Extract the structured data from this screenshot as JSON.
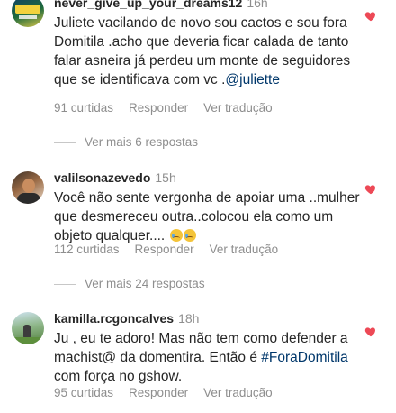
{
  "comments": [
    {
      "username": "never_give_up_your_dreams12",
      "time": "16h",
      "text": "Juliete vacilando de novo sou cactos e sou fora Domitila .acho que deveria ficar calada de tanto falar asneira já perdeu um monte de seguidores que se identificava com vc .",
      "mention": "@juliette",
      "likes": "91 curtidas",
      "reply_label": "Responder",
      "translate_label": "Ver tradução",
      "more_replies": "Ver mais 6 respostas"
    },
    {
      "username": "valilsonazevedo",
      "time": "15h",
      "text": "Você não sente vergonha de apoiar uma ..mulher que desmereceu outra..colocou ela como um objeto qualquer....",
      "emojis": [
        "crying-face",
        "crying-face"
      ],
      "likes": "112 curtidas",
      "reply_label": "Responder",
      "translate_label": "Ver tradução",
      "more_replies": "Ver mais 24 respostas"
    },
    {
      "username": "kamilla.rcgoncalves",
      "time": "18h",
      "text_before": "Ju , eu te adoro! Mas não tem como defender a machist@ da domentira. Então é",
      "hashtag": "#ForaDomitila",
      "text_after": "com força no gshow.",
      "likes": "95 curtidas",
      "reply_label": "Responder",
      "translate_label": "Ver tradução"
    }
  ],
  "colors": {
    "heart": "#ed4956",
    "secondary_text": "#8e8e8e",
    "link": "#00376b"
  }
}
